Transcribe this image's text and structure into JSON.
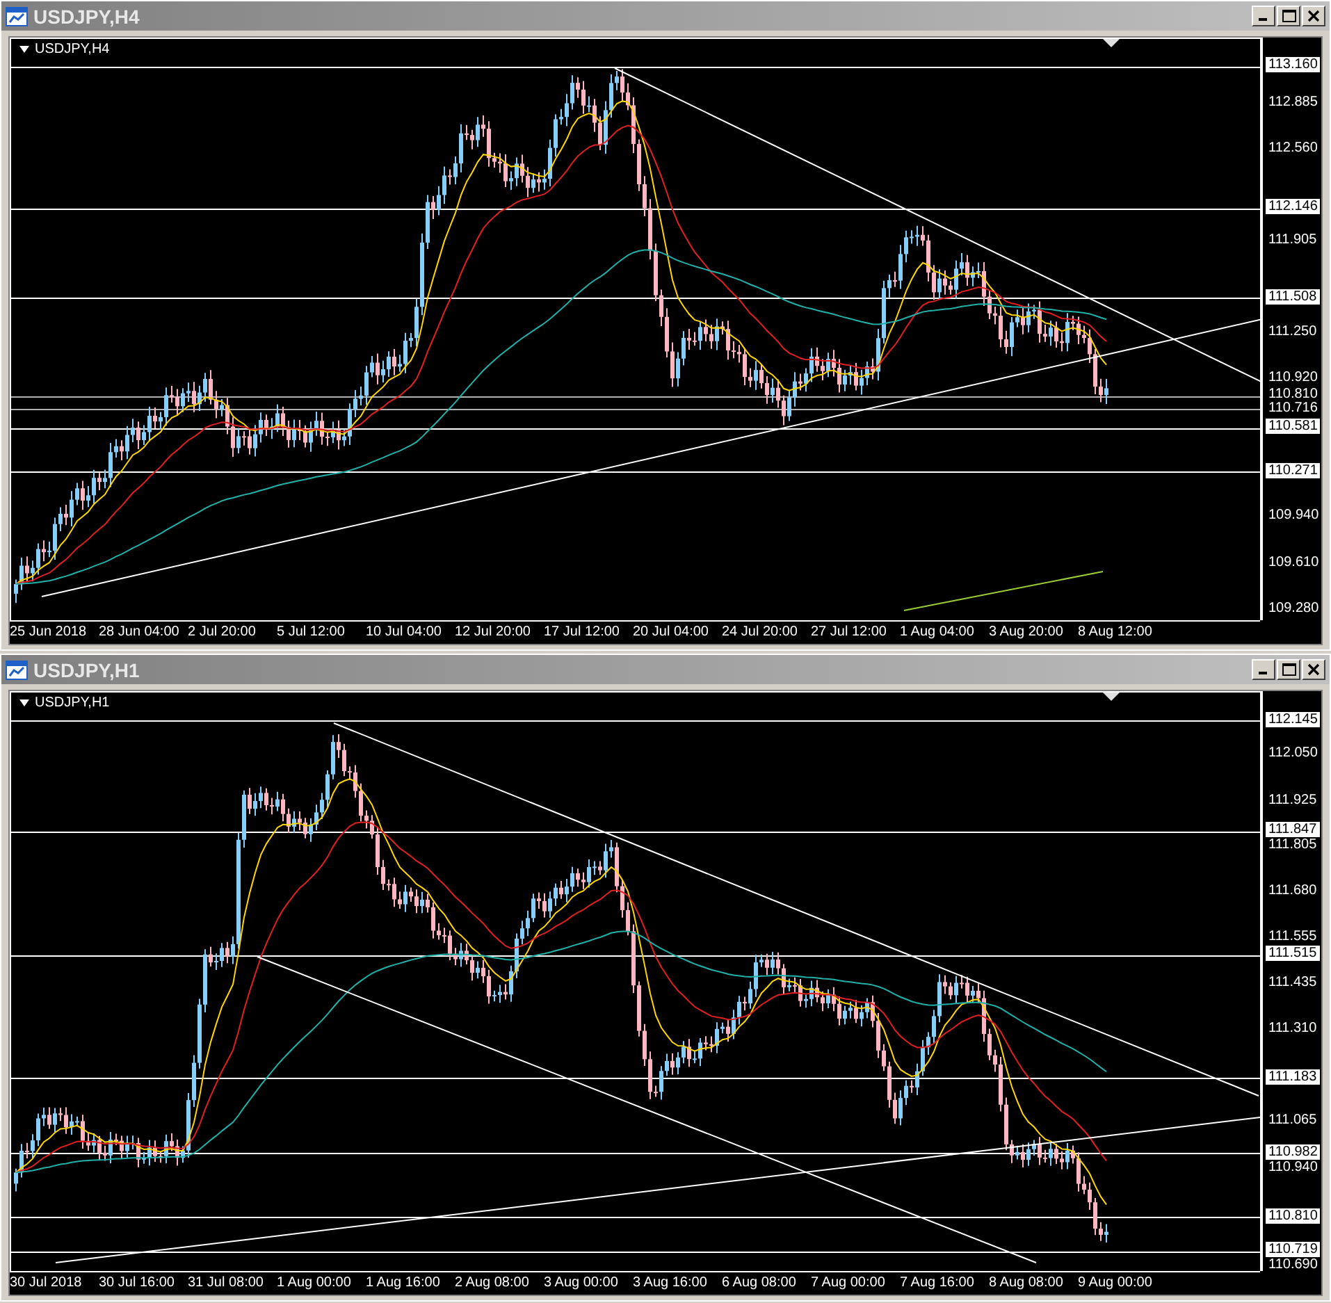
{
  "windows": [
    {
      "title": "USDJPY,H4",
      "chart_label": "USDJPY,H4",
      "price_ticks": [
        "112.885",
        "112.560",
        "111.905",
        "111.250",
        "110.920",
        "109.940",
        "109.610",
        "109.280"
      ],
      "price_levels": [
        {
          "text": "113.160",
          "kind": "boxed"
        },
        {
          "text": "112.146",
          "kind": "boxed"
        },
        {
          "text": "111.508",
          "kind": "boxed"
        },
        {
          "text": "110.810",
          "kind": "plain"
        },
        {
          "text": "110.716",
          "kind": "plain"
        },
        {
          "text": "110.581",
          "kind": "boxed"
        },
        {
          "text": "110.271",
          "kind": "boxed"
        }
      ],
      "time_labels": [
        "25 Jun 2018",
        "28 Jun 04:00",
        "2 Jul 20:00",
        "5 Jul 12:00",
        "10 Jul 04:00",
        "12 Jul 20:00",
        "17 Jul 12:00",
        "20 Jul 04:00",
        "24 Jul 20:00",
        "27 Jul 12:00",
        "1 Aug 04:00",
        "3 Aug 20:00",
        "8 Aug 12:00"
      ]
    },
    {
      "title": "USDJPY,H1",
      "chart_label": "USDJPY,H1",
      "price_ticks": [
        "112.050",
        "111.925",
        "111.805",
        "111.680",
        "111.555",
        "111.435",
        "111.310",
        "111.065",
        "110.940",
        "110.690"
      ],
      "price_levels": [
        {
          "text": "112.145",
          "kind": "boxed"
        },
        {
          "text": "111.847",
          "kind": "boxed"
        },
        {
          "text": "111.515",
          "kind": "boxed"
        },
        {
          "text": "111.183",
          "kind": "boxed"
        },
        {
          "text": "110.982",
          "kind": "boxed"
        },
        {
          "text": "110.810",
          "kind": "boxed"
        },
        {
          "text": "110.719",
          "kind": "boxed"
        }
      ],
      "time_labels": [
        "30 Jul 2018",
        "30 Jul 16:00",
        "31 Jul 08:00",
        "1 Aug 00:00",
        "1 Aug 16:00",
        "2 Aug 08:00",
        "3 Aug 00:00",
        "3 Aug 16:00",
        "6 Aug 08:00",
        "7 Aug 00:00",
        "7 Aug 16:00",
        "8 Aug 08:00",
        "9 Aug 00:00"
      ]
    }
  ]
}
